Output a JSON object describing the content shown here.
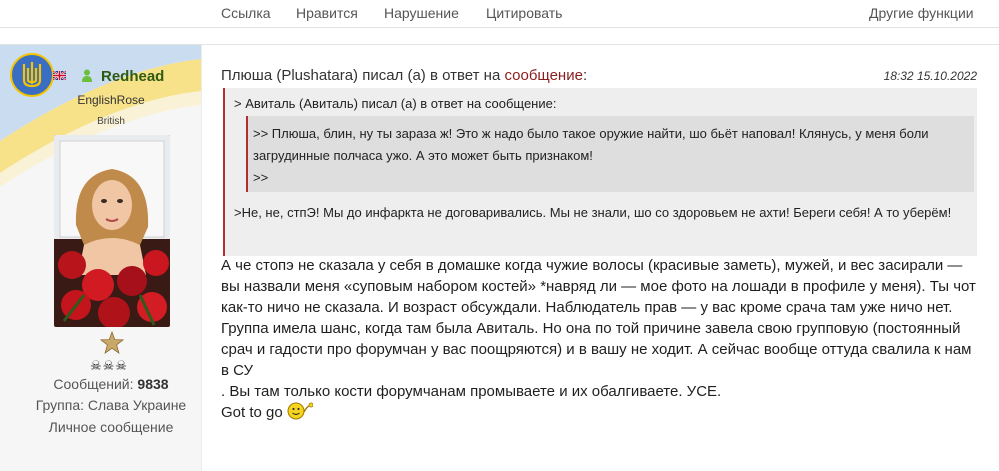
{
  "topbar": {
    "link": "Ссылка",
    "like": "Нравится",
    "report": "Нарушение",
    "quote": "Цитировать",
    "other": "Другие функции"
  },
  "user": {
    "name": "Redhead",
    "title": "EnglishRose",
    "country": "British",
    "rank_skulls": "☠☠☠",
    "posts_label": "Сообщений:",
    "posts_count": "9838",
    "group": "Группа: Слава Украине",
    "pm": "Личное сообщение"
  },
  "post": {
    "header_prefix": "Плюша (Plushatara) писал (а) в ответ на",
    "header_link": "сообщение",
    "header_suffix": ":",
    "datetime": "18:32 15.10.2022",
    "quote_title": "> Авиталь (Авиталь) писал (а) в ответ на сообщение:",
    "nested_quote_text": ">> Плюша, блин, ну ты зараза ж! Это ж надо было такое оружие найти, шо бьёт наповал! Клянусь, у меня боли загрудинные полчаса ужо. А это может быть признаком!",
    "nested_quote_tail": ">>",
    "quote_text": ">Не, не, стпЭ! Мы до инфаркта не договаривались. Мы не знали, шо со здоровьем не ахти! Береги себя! А то уберём!",
    "body_p1": "А че стопэ не сказала у себя в домашке когда чужие волосы (красивые заметь), мужей, и вес засирали — вы назвали меня «суповым набором костей» *навряд ли — мое фото на лошади в профиле у меня). Ты чот как-то ничо не сказала. И возраст обсуждали. Наблюдатель прав — у вас кроме срача там уже ничо нет. Группа имела шанс, когда там была Авиталь. Но она по той причине завела свою групповую (постоянный срач и гадости про форумчан у вас поощряются) и в вашу не ходит. А сейчас вообще оттуда свалила к нам в СУ",
    "body_p2": ". Вы там только кости форумчанам промываете и их обалгиваете. УСЕ.",
    "body_p3": "Got to go"
  },
  "icons": [
    "ukraine-emblem-icon",
    "uk-flag-icon",
    "online-user-icon",
    "rank-star-icon",
    "waving-smiley-icon"
  ],
  "colors": {
    "username": "#2e5a12",
    "quote_border": "#b03030",
    "message_link": "#8b1e1e"
  }
}
